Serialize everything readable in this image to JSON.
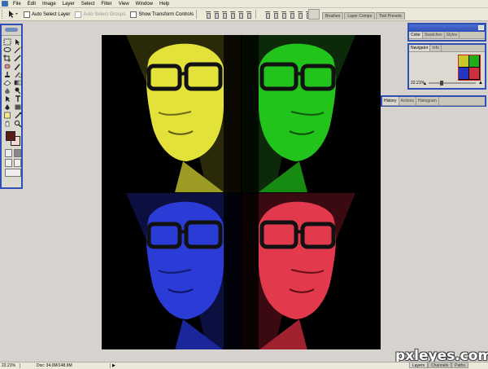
{
  "menubar": {
    "items": [
      "File",
      "Edit",
      "Image",
      "Layer",
      "Select",
      "Filter",
      "View",
      "Window",
      "Help"
    ]
  },
  "options": {
    "auto_select_layer": "Auto Select Layer",
    "auto_select_groups": "Auto Select Groups",
    "show_transform_controls": "Show Transform Controls"
  },
  "palette_well": {
    "tabs": [
      "Brushes",
      "Layer Comps",
      "Tool Presets"
    ]
  },
  "color_panel": {
    "tabs": [
      "Color",
      "Swatches",
      "Styles"
    ]
  },
  "navigator_panel": {
    "tabs": [
      "Navigator",
      "Info"
    ],
    "zoom": "22.21%"
  },
  "history_panel": {
    "tabs": [
      "History",
      "Actions",
      "Histogram"
    ]
  },
  "colors": {
    "foreground": "#5a1e1a",
    "background": "#f2d9cf",
    "selection_border": "#2f4fb5",
    "quadrant_tl": "#e3e23a",
    "quadrant_tr": "#22c41c",
    "quadrant_bl": "#2b3bd6",
    "quadrant_br": "#e23a4c"
  },
  "statusbar": {
    "zoom": "22.21%",
    "doc": "Doc: 34.0M/148.9M"
  },
  "layers_tabs": [
    "Layers",
    "Channels",
    "Paths"
  ],
  "watermark": "pxleyes.com"
}
